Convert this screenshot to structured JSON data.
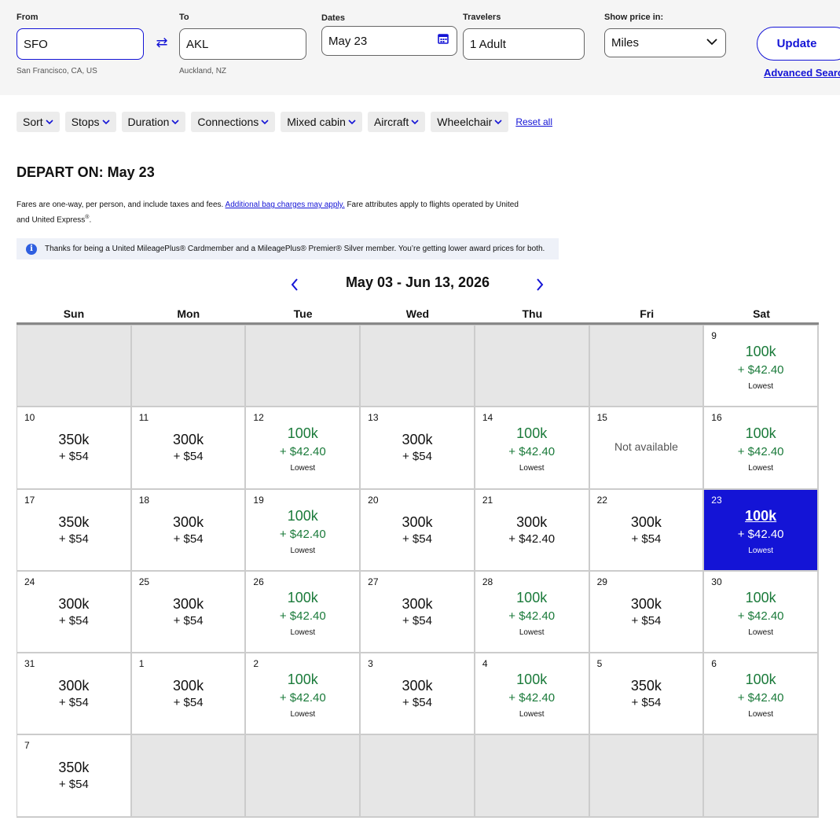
{
  "search": {
    "from_label": "From",
    "from_value": "SFO",
    "from_sub": "San Francisco, CA, US",
    "to_label": "To",
    "to_value": "AKL",
    "to_sub": "Auckland, NZ",
    "dates_label": "Dates",
    "dates_value": "May 23",
    "travelers_label": "Travelers",
    "travelers_value": "1 Adult",
    "price_label": "Show price in:",
    "price_value": "Miles",
    "update_label": "Update",
    "advanced_label": "Advanced Search"
  },
  "filters": [
    "Sort",
    "Stops",
    "Duration",
    "Connections",
    "Mixed cabin",
    "Aircraft",
    "Wheelchair"
  ],
  "reset_label": "Reset all",
  "depart_title": "DEPART ON: May 23",
  "fares": {
    "text1": "Fares are one-way, per person, and include taxes and fees. ",
    "link": "Additional bag charges may apply.",
    "text2": " Fare attributes apply to flights operated by United and United Express",
    "reg": "®",
    "end": "."
  },
  "notice": "Thanks for being a United MileagePlus® Cardmember and a MileagePlus® Premier® Silver member. You’re getting lower award prices for both.",
  "calendar": {
    "range": "May 03 - Jun 13, 2026",
    "days": [
      "Sun",
      "Mon",
      "Tue",
      "Wed",
      "Thu",
      "Fri",
      "Sat"
    ],
    "cells": [
      {
        "empty": true
      },
      {
        "empty": true
      },
      {
        "empty": true
      },
      {
        "empty": true
      },
      {
        "empty": true
      },
      {
        "empty": true
      },
      {
        "d": "9",
        "m": "100k",
        "t": "+ $42.40",
        "l": "Lowest",
        "g": true
      },
      {
        "d": "10",
        "m": "350k",
        "t": "+ $54"
      },
      {
        "d": "11",
        "m": "300k",
        "t": "+ $54"
      },
      {
        "d": "12",
        "m": "100k",
        "t": "+ $42.40",
        "l": "Lowest",
        "g": true
      },
      {
        "d": "13",
        "m": "300k",
        "t": "+ $54"
      },
      {
        "d": "14",
        "m": "100k",
        "t": "+ $42.40",
        "l": "Lowest",
        "g": true
      },
      {
        "d": "15",
        "na": "Not available"
      },
      {
        "d": "16",
        "m": "100k",
        "t": "+ $42.40",
        "l": "Lowest",
        "g": true
      },
      {
        "d": "17",
        "m": "350k",
        "t": "+ $54"
      },
      {
        "d": "18",
        "m": "300k",
        "t": "+ $54"
      },
      {
        "d": "19",
        "m": "100k",
        "t": "+ $42.40",
        "l": "Lowest",
        "g": true
      },
      {
        "d": "20",
        "m": "300k",
        "t": "+ $54"
      },
      {
        "d": "21",
        "m": "300k",
        "t": "+ $42.40"
      },
      {
        "d": "22",
        "m": "300k",
        "t": "+ $54"
      },
      {
        "d": "23",
        "m": "100k",
        "t": "+ $42.40",
        "l": "Lowest",
        "g": true,
        "sel": true
      },
      {
        "d": "24",
        "m": "300k",
        "t": "+ $54"
      },
      {
        "d": "25",
        "m": "300k",
        "t": "+ $54"
      },
      {
        "d": "26",
        "m": "100k",
        "t": "+ $42.40",
        "l": "Lowest",
        "g": true
      },
      {
        "d": "27",
        "m": "300k",
        "t": "+ $54"
      },
      {
        "d": "28",
        "m": "100k",
        "t": "+ $42.40",
        "l": "Lowest",
        "g": true
      },
      {
        "d": "29",
        "m": "300k",
        "t": "+ $54"
      },
      {
        "d": "30",
        "m": "100k",
        "t": "+ $42.40",
        "l": "Lowest",
        "g": true
      },
      {
        "d": "31",
        "m": "300k",
        "t": "+ $54"
      },
      {
        "d": "1",
        "m": "300k",
        "t": "+ $54"
      },
      {
        "d": "2",
        "m": "100k",
        "t": "+ $42.40",
        "l": "Lowest",
        "g": true
      },
      {
        "d": "3",
        "m": "300k",
        "t": "+ $54"
      },
      {
        "d": "4",
        "m": "100k",
        "t": "+ $42.40",
        "l": "Lowest",
        "g": true
      },
      {
        "d": "5",
        "m": "350k",
        "t": "+ $54"
      },
      {
        "d": "6",
        "m": "100k",
        "t": "+ $42.40",
        "l": "Lowest",
        "g": true
      },
      {
        "d": "7",
        "m": "350k",
        "t": "+ $54"
      },
      {
        "empty": true
      },
      {
        "empty": true
      },
      {
        "empty": true
      },
      {
        "empty": true
      },
      {
        "empty": true
      },
      {
        "empty": true
      }
    ]
  },
  "colors": {
    "accent": "#1414d6",
    "lowest": "#1a7a3a",
    "empty": "#e6e6e6"
  }
}
